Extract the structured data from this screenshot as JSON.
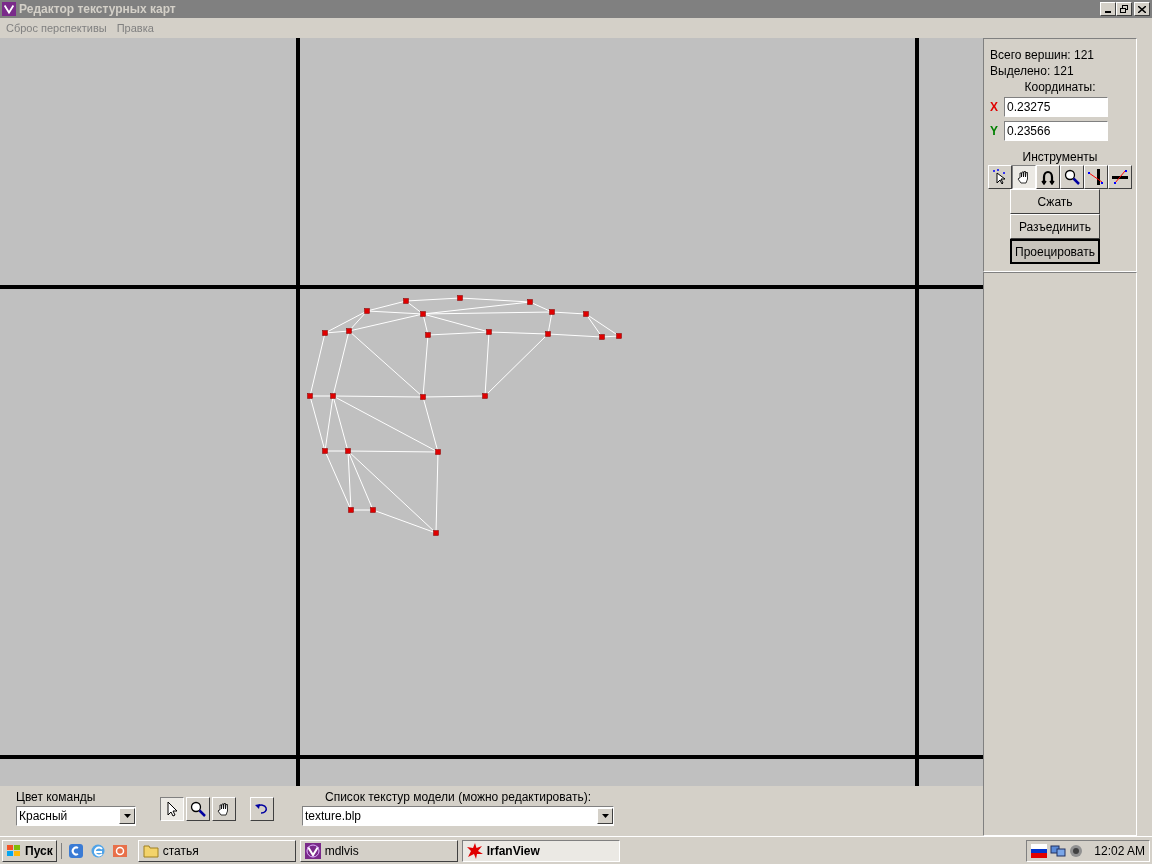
{
  "window": {
    "title": "Редактор текстурных карт"
  },
  "menu": [
    "Сброс перспективы",
    "Правка"
  ],
  "panel": {
    "total_vertices": "Всего вершин: 121",
    "selected_vertices": "Выделено: 121",
    "coords_label": "Координаты:",
    "x_label": "X",
    "x_value": "0.23275",
    "y_label": "Y",
    "y_value": "0.23566",
    "tools_label": "Инструменты",
    "tools": [
      {
        "kind": "select-dots",
        "selected": false
      },
      {
        "kind": "hand",
        "selected": true
      },
      {
        "kind": "rotate",
        "selected": false
      },
      {
        "kind": "zoom",
        "selected": false
      },
      {
        "kind": "mirror-v",
        "selected": false
      },
      {
        "kind": "mirror-h",
        "selected": false
      }
    ],
    "buttons": [
      {
        "label": "Сжать",
        "focused": false
      },
      {
        "label": "Разъединить",
        "focused": false
      },
      {
        "label": "Проецировать",
        "focused": true
      }
    ]
  },
  "bottom": {
    "team_color_label": "Цвет команды",
    "team_color_value": "Красный",
    "view_tools": [
      {
        "kind": "pointer",
        "selected": true
      },
      {
        "kind": "zoom",
        "selected": false
      },
      {
        "kind": "hand",
        "selected": false
      }
    ],
    "texture_label": "Список текстур модели (можно редактировать):",
    "texture_value": "texture.blp"
  },
  "taskbar": {
    "start": "Пуск",
    "quick_launch": [
      {
        "kind": "app"
      },
      {
        "kind": "browser"
      },
      {
        "kind": "media"
      }
    ],
    "tasks": [
      {
        "kind": "folder",
        "label": "статья",
        "selected": false
      },
      {
        "kind": "mdlvis",
        "label": "mdlvis",
        "selected": false
      },
      {
        "kind": "irfan",
        "label": "IrfanView",
        "selected": true
      }
    ],
    "clock": "12:02 AM"
  }
}
